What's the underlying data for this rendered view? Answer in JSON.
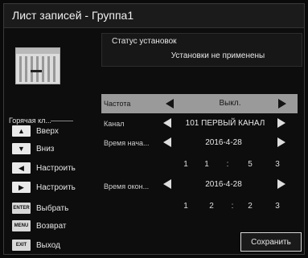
{
  "window": {
    "title": "Лист записей - Группа1"
  },
  "status": {
    "label": "Статус установок",
    "value": "Установки не применены"
  },
  "help": {
    "hotkeys_label": "Горячая кл...",
    "items": [
      {
        "key": "▲",
        "label": "Вверх"
      },
      {
        "key": "▼",
        "label": "Вниз"
      },
      {
        "key": "◀",
        "label": "Настроить"
      },
      {
        "key": "▶",
        "label": "Настроить"
      },
      {
        "key": "ENTER",
        "label": "Выбрать"
      },
      {
        "key": "MENU",
        "label": "Возврат"
      },
      {
        "key": "EXIT",
        "label": "Выход"
      }
    ]
  },
  "settings": {
    "frequency": {
      "label": "Частота",
      "value": "Выкл."
    },
    "channel": {
      "label": "Канал",
      "value": "101 ПЕРВЫЙ КАНАЛ"
    },
    "start": {
      "label": "Время нача...",
      "date": "2016-4-28",
      "time": [
        "1",
        "1",
        ":",
        "5",
        "3"
      ]
    },
    "end": {
      "label": "Время окон...",
      "date": "2016-4-28",
      "time": [
        "1",
        "2",
        ":",
        "2",
        "3"
      ]
    }
  },
  "buttons": {
    "save": "Сохранить"
  }
}
